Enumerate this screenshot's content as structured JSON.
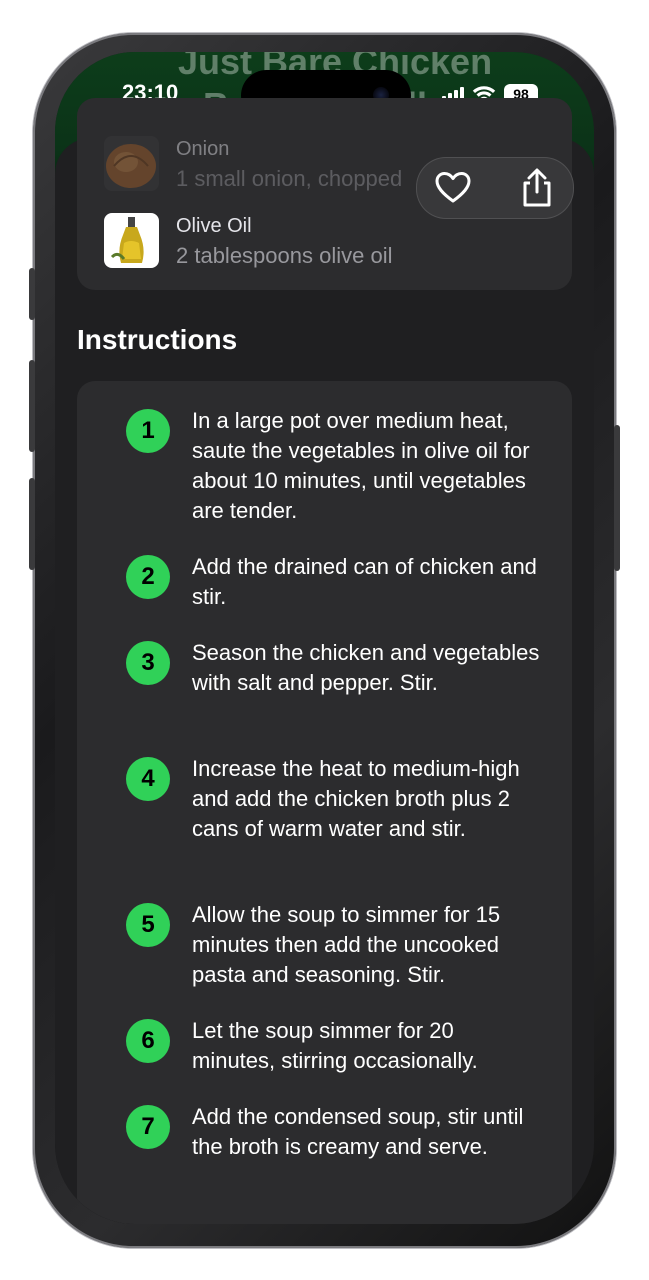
{
  "status": {
    "time": "23:10",
    "battery": "98"
  },
  "header": {
    "title": "Just Bare Chicken Breast Noodles"
  },
  "ingredients": [
    {
      "name": "Onion",
      "quantity": "1 small onion, chopped"
    },
    {
      "name": "Olive Oil",
      "quantity": "2 tablespoons olive oil"
    }
  ],
  "actions": {
    "favorite_icon": "heart-icon",
    "share_icon": "share-icon"
  },
  "instructions": {
    "title": "Instructions",
    "steps": [
      {
        "number": "1",
        "text": "In a large pot over medium heat, saute the vegetables in olive oil for about 10 minutes, until vegetables are tender."
      },
      {
        "number": "2",
        "text": "Add the drained can of chicken and stir."
      },
      {
        "number": "3",
        "text": "Season the chicken and vegetables with salt and pepper. Stir."
      },
      {
        "number": "4",
        "text": "Increase the heat to medium-high and add the chicken broth plus 2 cans of warm water and stir."
      },
      {
        "number": "5",
        "text": "Allow the soup to simmer for 15 minutes then add the uncooked pasta and seasoning. Stir."
      },
      {
        "number": "6",
        "text": "Let the soup simmer for 20 minutes, stirring occasionally."
      },
      {
        "number": "7",
        "text": "Add the condensed soup, stir until the broth is creamy and serve."
      }
    ]
  },
  "colors": {
    "accent": "#30d158",
    "card": "#2c2c2e",
    "background": "#1f1f21",
    "header": "#0b3318"
  }
}
